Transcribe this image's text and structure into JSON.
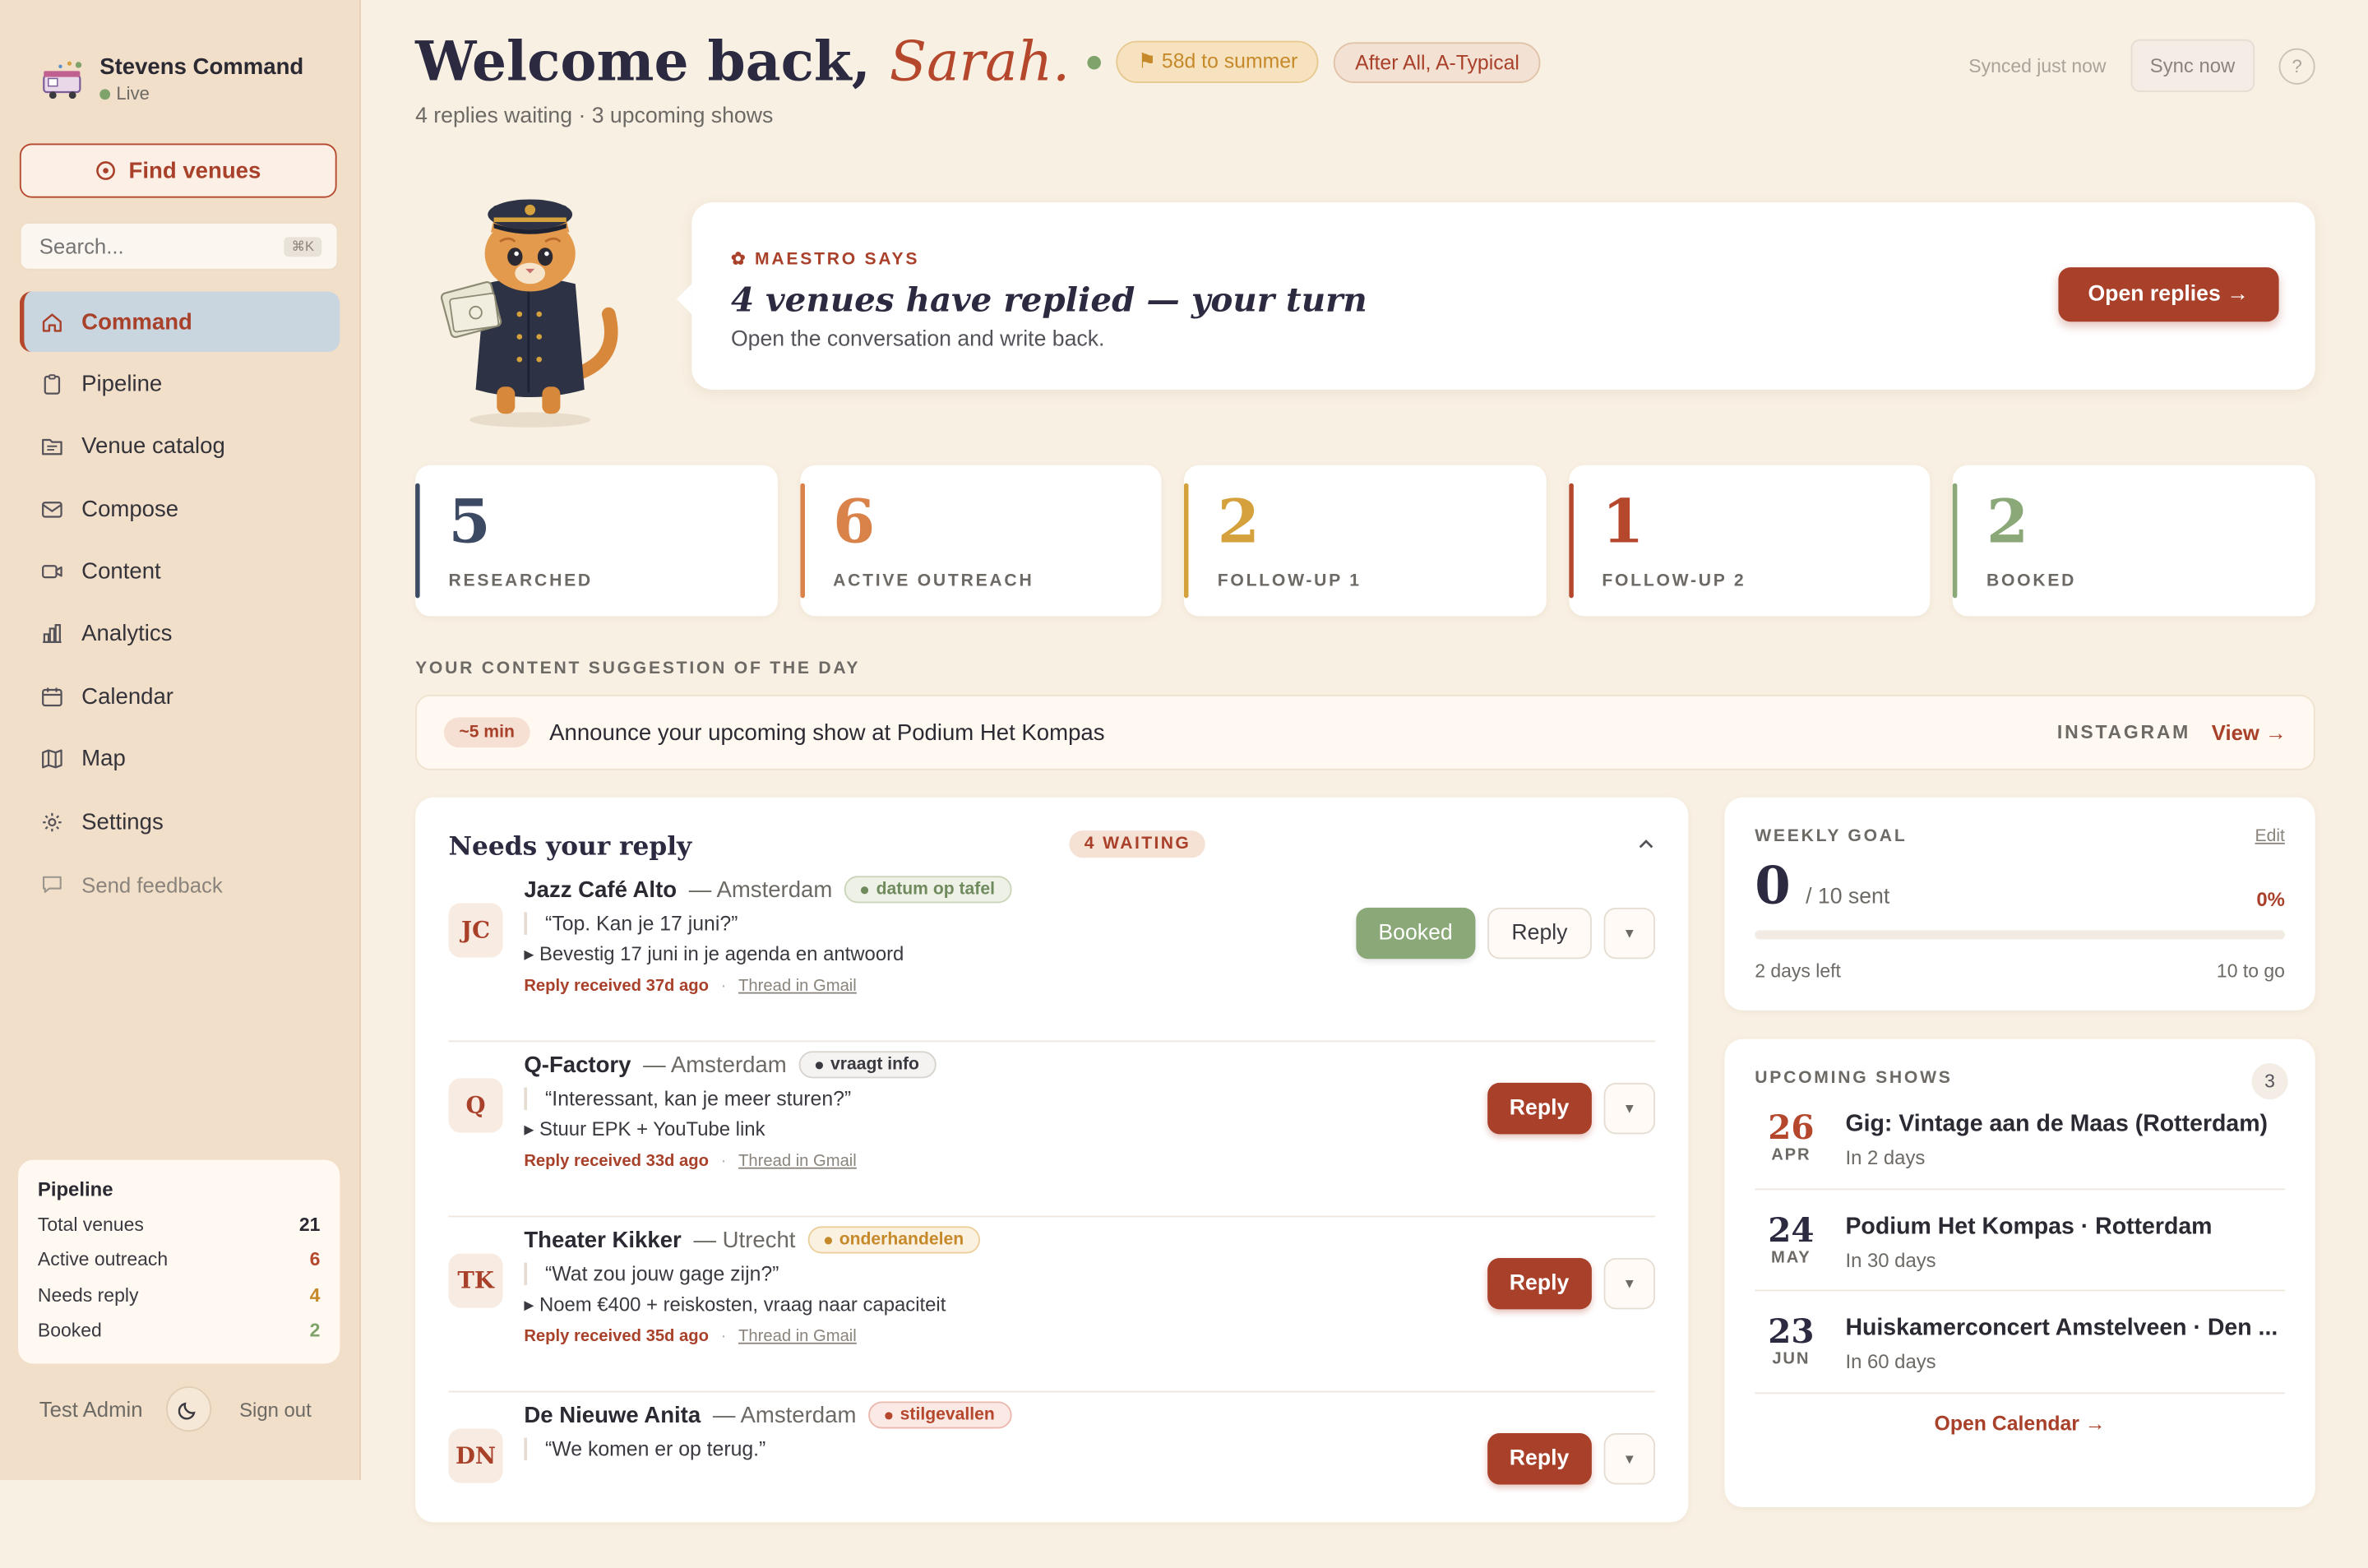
{
  "brand": {
    "title": "Stevens Command",
    "status": "Live"
  },
  "sidebar": {
    "find_label": "Find venues",
    "search_placeholder": "Search...",
    "search_kbd": "⌘K",
    "nav": [
      {
        "label": "Command",
        "icon": "home-icon",
        "active": true
      },
      {
        "label": "Pipeline",
        "icon": "clipboard-icon"
      },
      {
        "label": "Venue catalog",
        "icon": "folder-icon"
      },
      {
        "label": "Compose",
        "icon": "mail-icon"
      },
      {
        "label": "Content",
        "icon": "video-icon"
      },
      {
        "label": "Analytics",
        "icon": "bar-chart-icon"
      },
      {
        "label": "Calendar",
        "icon": "calendar-icon"
      },
      {
        "label": "Map",
        "icon": "map-icon"
      },
      {
        "label": "Settings",
        "icon": "gear-icon"
      }
    ],
    "feedback_label": "Send feedback",
    "pipeline": {
      "title": "Pipeline",
      "rows": [
        {
          "label": "Total venues",
          "value": "21",
          "color": "#2b2a33"
        },
        {
          "label": "Active outreach",
          "value": "6",
          "color": "#b4472c"
        },
        {
          "label": "Needs reply",
          "value": "4",
          "color": "#c6892a"
        },
        {
          "label": "Booked",
          "value": "2",
          "color": "#7fa36a"
        }
      ]
    },
    "footer": {
      "user": "Test Admin",
      "signout": "Sign out"
    }
  },
  "header": {
    "welcome": "Welcome back,",
    "name": "Sarah.",
    "summer_pill": "⚑ 58d to summer",
    "artist_pill": "After All, A-Typical",
    "subtitle": "4 replies waiting · 3 upcoming shows",
    "synced": "Synced just now",
    "sync_btn": "Sync now",
    "help": "?"
  },
  "maestro": {
    "label": "✿ MAESTRO SAYS",
    "headline": "4 venues have replied — your turn",
    "sub": "Open the conversation and write back.",
    "button": "Open replies →"
  },
  "stats": [
    {
      "value": "5",
      "label": "RESEARCHED",
      "color": "#3d4a63"
    },
    {
      "value": "6",
      "label": "ACTIVE OUTREACH",
      "color": "#d9824a"
    },
    {
      "value": "2",
      "label": "FOLLOW-UP 1",
      "color": "#d4a13d"
    },
    {
      "value": "1",
      "label": "FOLLOW-UP 2",
      "color": "#b4472c"
    },
    {
      "value": "2",
      "label": "BOOKED",
      "color": "#8aa878"
    }
  ],
  "suggestion": {
    "section_label": "YOUR CONTENT SUGGESTION OF THE DAY",
    "time": "~5 min",
    "text": "Announce your upcoming show at Podium Het Kompas",
    "platform": "INSTAGRAM",
    "view": "View →"
  },
  "replies": {
    "title": "Needs your reply",
    "waiting": "4 WAITING",
    "items": [
      {
        "initials": "JC",
        "venue": "Jazz Café Alto",
        "city": "— Amsterdam",
        "tag": "datum op tafel",
        "tag_bg": "#eef1e6",
        "tag_border": "#c9d5b9",
        "tag_color": "#6f8a5c",
        "quote": "“Top. Kan je 17 juni?”",
        "action": "▸ Bevestig 17 juni in je agenda en antwoord",
        "received": "Reply received 37d ago",
        "gmail": "Thread in Gmail",
        "booked": "Booked",
        "reply": "Reply",
        "style": "outline"
      },
      {
        "initials": "Q",
        "venue": "Q-Factory",
        "city": "— Amsterdam",
        "tag": "vraagt info",
        "tag_bg": "#f4f3f1",
        "tag_border": "#d6d2cc",
        "tag_color": "#3a3940",
        "quote": "“Interessant, kan je meer sturen?”",
        "action": "▸ Stuur EPK + YouTube link",
        "received": "Reply received 33d ago",
        "gmail": "Thread in Gmail",
        "reply": "Reply",
        "style": "filled"
      },
      {
        "initials": "TK",
        "venue": "Theater Kikker",
        "city": "— Utrecht",
        "tag": "onderhandelen",
        "tag_bg": "#fbf1e0",
        "tag_border": "#ebcf9a",
        "tag_color": "#c6892a",
        "quote": "“Wat zou jouw gage zijn?”",
        "action": "▸ Noem €400 + reiskosten, vraag naar capaciteit",
        "received": "Reply received 35d ago",
        "gmail": "Thread in Gmail",
        "reply": "Reply",
        "style": "filled"
      },
      {
        "initials": "DN",
        "venue": "De Nieuwe Anita",
        "city": "— Amsterdam",
        "tag": "stilgevallen",
        "tag_bg": "#fbe9e6",
        "tag_border": "#ecb8ae",
        "tag_color": "#b4472c",
        "quote": "“We komen er op terug.”",
        "action": "",
        "received": "",
        "gmail": "",
        "reply": "Reply",
        "style": "filled"
      }
    ]
  },
  "goal": {
    "label": "WEEKLY GOAL",
    "edit": "Edit",
    "value": "0",
    "of": "/ 10 sent",
    "pct": "0%",
    "progress": 0,
    "left": "2 days left",
    "to_go": "10 to go"
  },
  "shows": {
    "label": "UPCOMING SHOWS",
    "count": "3",
    "items": [
      {
        "day": "26",
        "month": "APR",
        "title": "Gig: Vintage aan de Maas (Rotterdam)",
        "when": "In 2 days",
        "color": "#b4472c"
      },
      {
        "day": "24",
        "month": "MAY",
        "title": "Podium Het Kompas · Rotterdam",
        "when": "In 30 days",
        "color": "#2b2a40"
      },
      {
        "day": "23",
        "month": "JUN",
        "title": "Huiskamerconcert Amstelveen · Den ...",
        "when": "In 60 days",
        "color": "#2b2a40"
      }
    ],
    "open_calendar": "Open Calendar →"
  }
}
